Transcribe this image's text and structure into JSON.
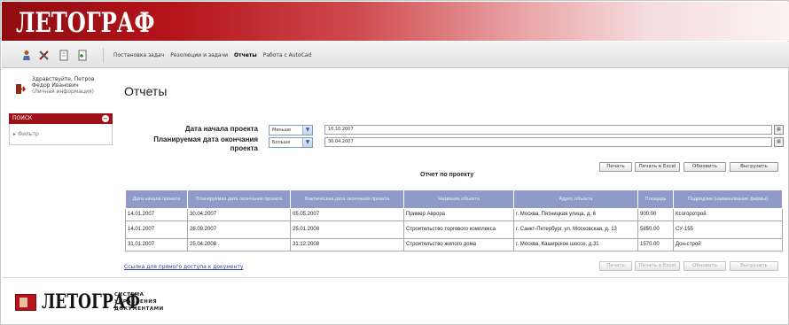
{
  "app": {
    "logo_text": "ЛЕТОГРАФ"
  },
  "toolbar": {
    "icons": [
      "user-icon",
      "tools-icon",
      "document-icon",
      "add-document-icon"
    ],
    "menu": [
      {
        "label": "Постановка задач",
        "active": false
      },
      {
        "label": "Резолюции и задачи",
        "active": false
      },
      {
        "label": "Отчеты",
        "active": true
      },
      {
        "label": "Работа с AutoCad",
        "active": false
      }
    ]
  },
  "user": {
    "greeting": "Здравствуйте, Петров",
    "name": "Федор Иванович",
    "info_link": "(Личная информация)"
  },
  "sidebar": {
    "header": "ПОИСК",
    "items": [
      {
        "label": "Фильтр"
      }
    ]
  },
  "page": {
    "title": "Отчеты"
  },
  "filters": {
    "start_label": "Дата начала проекта",
    "start_condition": "Меньше",
    "start_date": "16.10.2007",
    "end_label_line1": "Планируемая дата окончания",
    "end_label_line2": "проекта",
    "end_condition": "Больше",
    "end_date": "30.04.2007"
  },
  "report": {
    "title": "Отчет по проекту",
    "buttons_top": [
      "Печать",
      "Печать в Excel",
      "Обновить",
      "Выгрузить"
    ],
    "buttons_bottom": [
      "Печать",
      "Печать в Excel",
      "Обновить",
      "Выгрузить"
    ]
  },
  "table": {
    "columns": [
      "Дата начала проекта",
      "Планируемая дата окончания проекта",
      "Фактическая дата окончания проекта",
      "Название объекта",
      "Адрес объекта",
      "Площадь",
      "Подрядчик (наименование фирмы)"
    ],
    "rows": [
      [
        "14.01.2007",
        "30.04.2007",
        "05.05.2007",
        "Пример Аврора",
        "г. Москва, Пятницкая улица, д. 6",
        "900.00",
        "Ксогоротрой"
      ],
      [
        "14.01.2007",
        "26.09.2007",
        "25.01.2008",
        "Строительство торгового комплекса",
        "г. Санкт-Петербург, ул. Московская, д. 13",
        "5850.00",
        "СУ-155"
      ],
      [
        "31.01.2007",
        "25.04.2008",
        "31.12.2008",
        "Строительство жилого дома",
        "г. Москва, Каширское шоссе, д.31",
        "1570.00",
        "Дон-строй"
      ]
    ]
  },
  "links": {
    "direct_access": "Ссылка для прямого доступа к документу"
  },
  "footer": {
    "logo_text": "ЛЕТОГРАФ",
    "tagline": [
      "СИСТЕМА",
      "УПРАВЛЕНИЯ",
      "ДОКУМЕНТАМИ"
    ]
  },
  "colors": {
    "brand_red": "#9d1218",
    "table_header": "#8f9ac8",
    "link": "#1f3fa8"
  }
}
